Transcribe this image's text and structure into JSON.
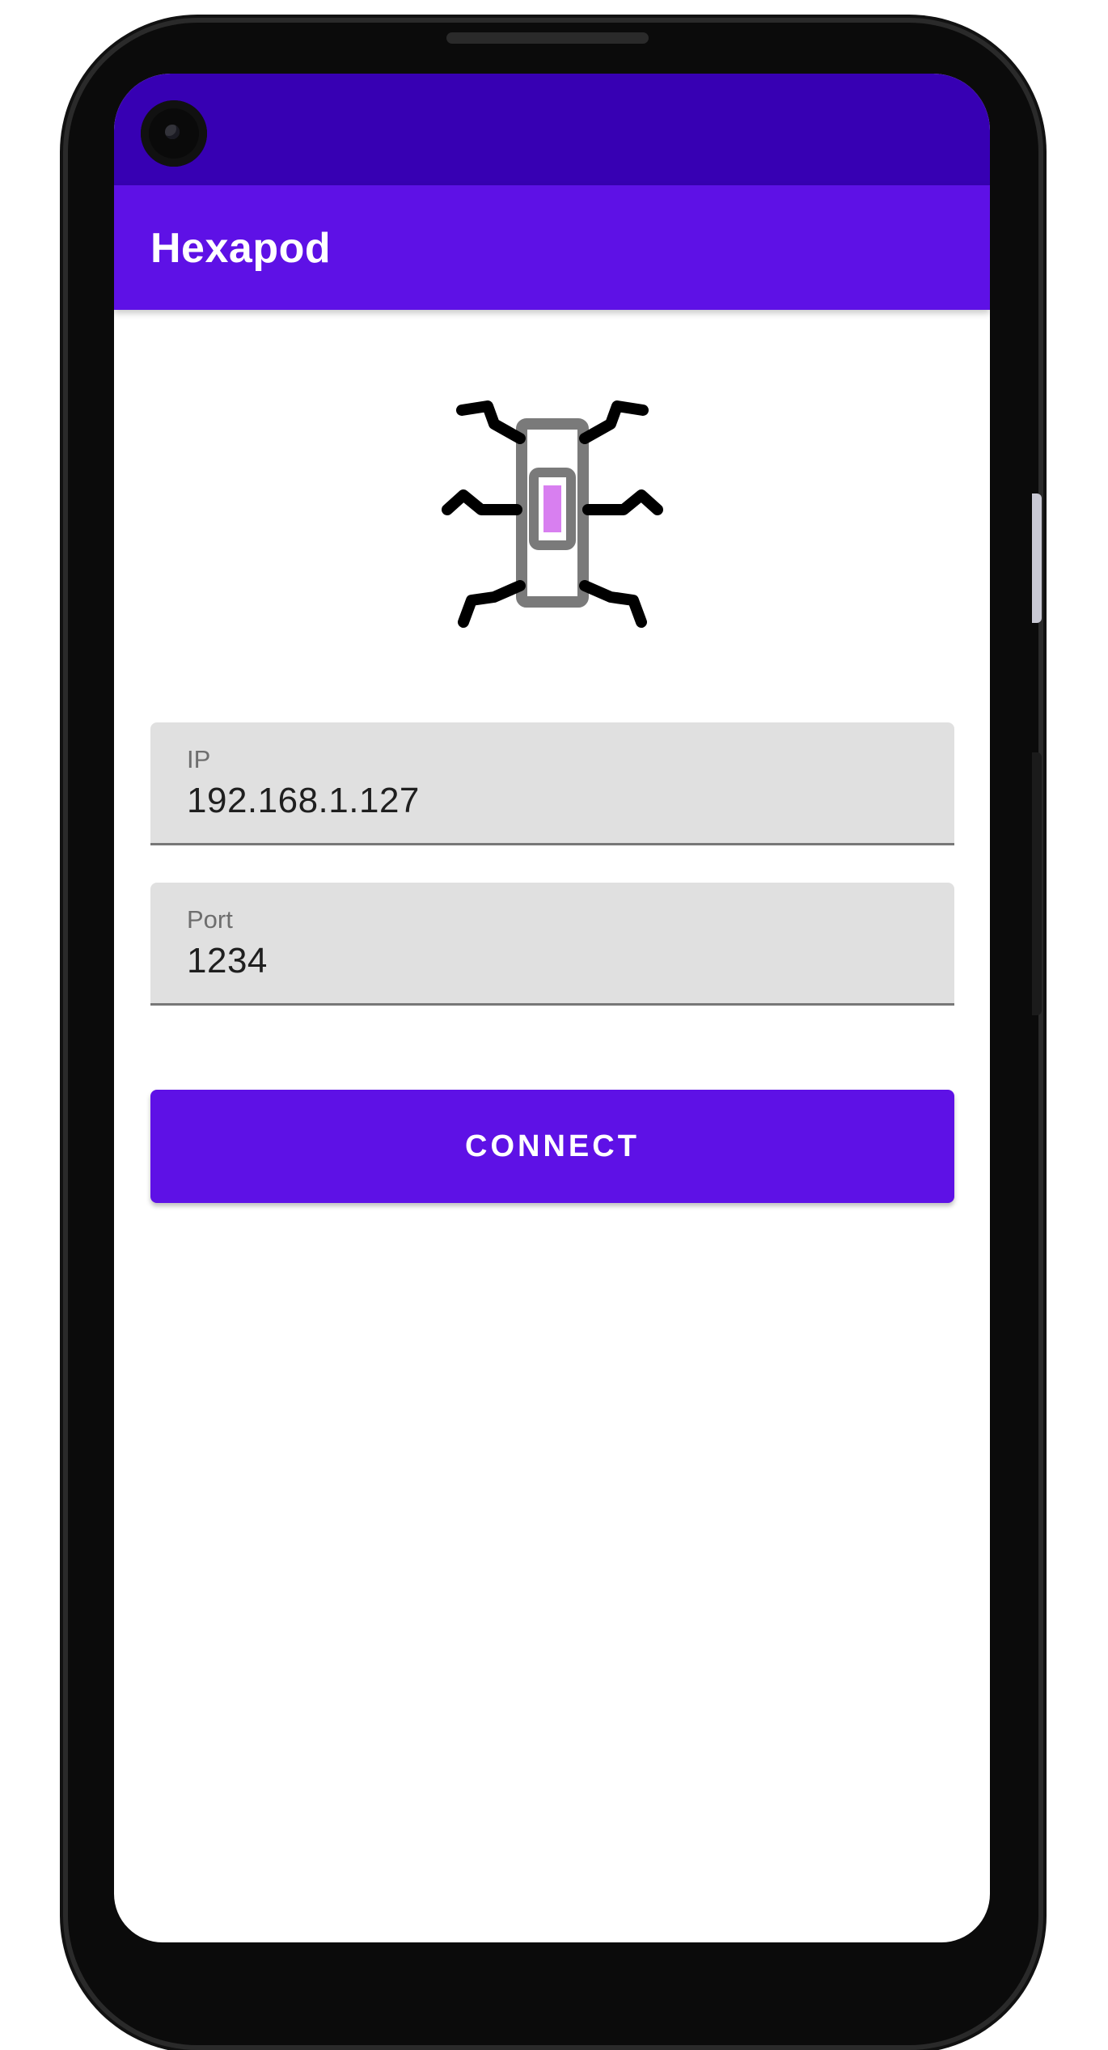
{
  "app": {
    "title": "Hexapod"
  },
  "logo": {
    "icon": "hexapod-robot-icon"
  },
  "form": {
    "ip": {
      "label": "IP",
      "value": "192.168.1.127"
    },
    "port": {
      "label": "Port",
      "value": "1234"
    },
    "connect_label": "CONNECT"
  },
  "colors": {
    "primary": "#5e11e6",
    "primary_dark": "#3700b3",
    "field_bg": "#e0e0e0",
    "logo_body": "#7a7a7a",
    "logo_core": "#d87ff0"
  }
}
